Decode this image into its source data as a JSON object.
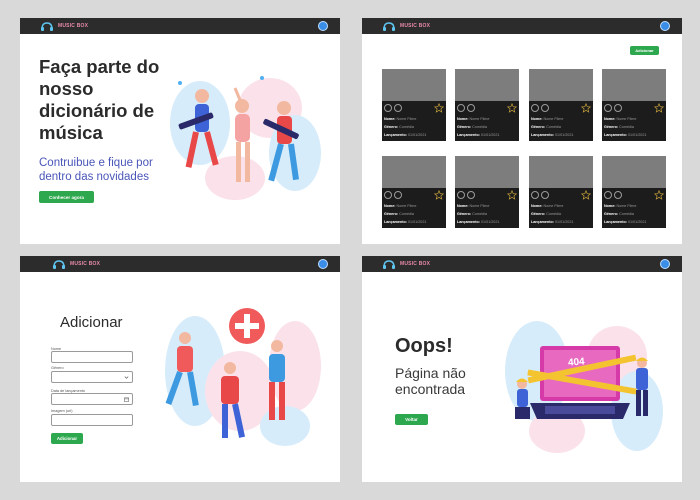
{
  "brand": {
    "name": "MUSIC BOX"
  },
  "home": {
    "title": "Faça parte do nosso dicionário de música",
    "subtitle": "Contruibue e fique por dentro das novidades",
    "cta": "Conhecer agora"
  },
  "library": {
    "add_button": "Adicionar",
    "field_labels": {
      "name": "Nome:",
      "genre": "Gênero:",
      "release": "Lançamento:"
    },
    "cards": [
      {
        "name": "Nome Filme",
        "genre": "Comédia",
        "release": "01/01/2021"
      },
      {
        "name": "Nome Filme",
        "genre": "Comédia",
        "release": "01/01/2021"
      },
      {
        "name": "Nome Filme",
        "genre": "Comédia",
        "release": "01/01/2021"
      },
      {
        "name": "Nome Filme",
        "genre": "Comédia",
        "release": "01/01/2021"
      },
      {
        "name": "Nome Filme",
        "genre": "Comédia",
        "release": "01/01/2021"
      },
      {
        "name": "Nome Filme",
        "genre": "Comédia",
        "release": "01/01/2021"
      },
      {
        "name": "Nome Filme",
        "genre": "Comédia",
        "release": "01/01/2021"
      },
      {
        "name": "Nome Filme",
        "genre": "Comédia",
        "release": "01/01/2021"
      }
    ]
  },
  "add_form": {
    "title": "Adicionar",
    "labels": {
      "name": "Nome",
      "genre": "Gênero",
      "release": "Data de lançamento",
      "image": "Imagem (url)"
    },
    "values": {
      "name": "",
      "genre": "",
      "release": "",
      "image": ""
    },
    "submit": "Adicionar"
  },
  "not_found": {
    "title": "Oops!",
    "subtitle": "Página não encontrada",
    "button": "Voltar",
    "code": "404"
  },
  "colors": {
    "topbar": "#2c2c2c",
    "accent_green": "#2ea84f",
    "subtitle_blue": "#4a56b8",
    "brand_pink": "#e88aa8",
    "card_bg": "#1c1c1c"
  }
}
